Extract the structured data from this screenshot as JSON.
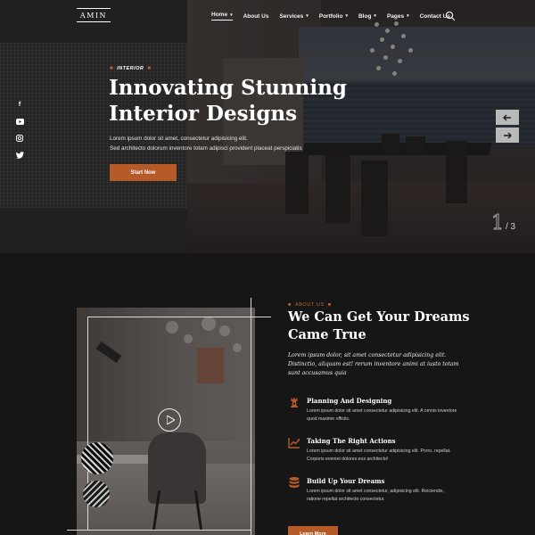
{
  "brand": {
    "logo_text": "AMIN"
  },
  "nav": {
    "items": [
      {
        "label": "Home",
        "has_dropdown": true,
        "active": true
      },
      {
        "label": "About Us",
        "has_dropdown": false
      },
      {
        "label": "Services",
        "has_dropdown": true
      },
      {
        "label": "Portfolio",
        "has_dropdown": true
      },
      {
        "label": "Blog",
        "has_dropdown": true
      },
      {
        "label": "Pages",
        "has_dropdown": true
      },
      {
        "label": "Contact Us",
        "has_dropdown": false
      }
    ],
    "search_icon": "search-icon"
  },
  "socials": [
    {
      "icon": "facebook-icon",
      "glyph": "f"
    },
    {
      "icon": "youtube-icon",
      "glyph": "▶"
    },
    {
      "icon": "instagram-icon",
      "glyph": "◎"
    },
    {
      "icon": "twitter-icon",
      "glyph": "✦"
    }
  ],
  "hero": {
    "eyebrow": "INTERIOR",
    "title_line1": "Innovating Stunning",
    "title_line2": "Interior Designs",
    "desc_line1": "Lorem ipsum dolor sit amet, consectetur adipisicing elit.",
    "desc_line2": "Sed architecto dolorum inventore totam adipisci provident placeat perspiciatis",
    "cta_label": "Start Now",
    "slide_current": "1",
    "slide_total": "/ 3",
    "prev_icon": "arrow-left-icon",
    "next_icon": "arrow-right-icon"
  },
  "about": {
    "eyebrow": "ABOUT US",
    "title_line1": "We Can Get Your Dreams",
    "title_line2": "Came True",
    "intro": "Lorem ipsum dolor, sit amet consectetur adipisicing elit. Distinctio, aliquam est! rerum inventore animi at iusto totam sunt accusamus quia",
    "features": [
      {
        "icon": "tower-icon",
        "title": "Planning And Designing",
        "desc": "Lorem ipsum dolor sit amet consectetur adipisicing elit. A omnis inventore quod maxime officiis."
      },
      {
        "icon": "chart-icon",
        "title": "Taking The Right Actions",
        "desc": "Lorem ipsum dolor sit amet consectetur adipisicing elit. Porro, repellat. Corporis eveniet dolores eos architecto!"
      },
      {
        "icon": "database-icon",
        "title": "Build Up Your Dreams",
        "desc": "Lorem ipsum dolor sit amet consectetur, adipisicing elit. Reiciendis, ratione repellat architecto consectetur."
      }
    ],
    "cta_label": "Learn More",
    "play_icon": "play-icon"
  },
  "colors": {
    "accent": "#b65b27",
    "background": "#161616",
    "text": "#ffffff"
  }
}
